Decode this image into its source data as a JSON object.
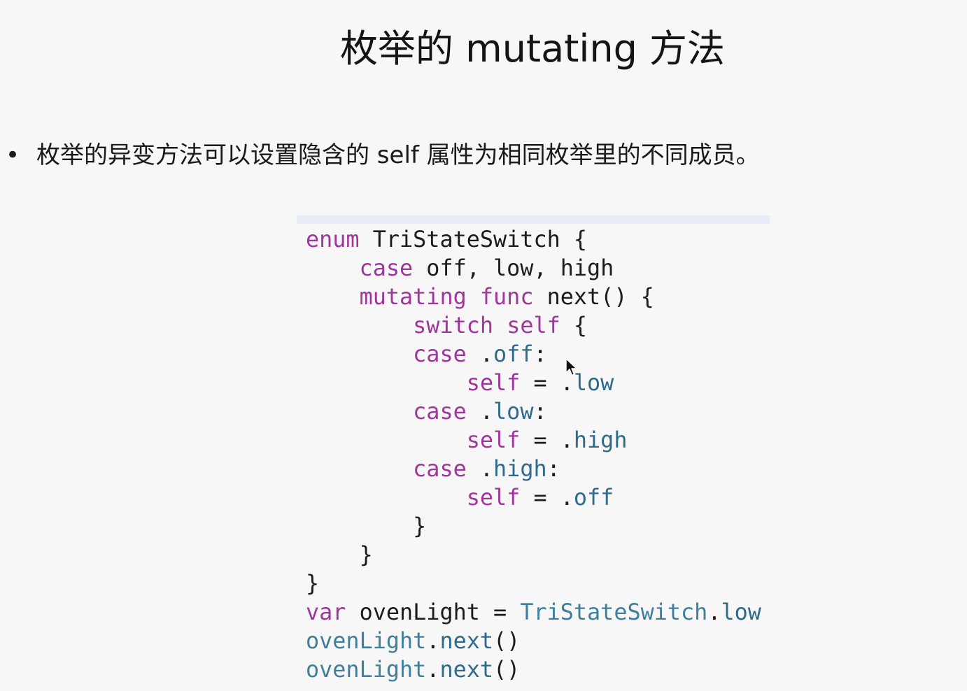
{
  "slide": {
    "title": "枚举的 mutating 方法",
    "bullet_marker": "•",
    "bullet_text": "枚举的异变方法可以设置隐含的 self 属性为相同枚举里的不同成员。"
  },
  "code": {
    "lines": [
      [
        {
          "t": "enum",
          "c": "kw"
        },
        {
          "t": " TriStateSwitch {",
          "c": "pl"
        }
      ],
      [
        {
          "t": "    ",
          "c": "pl"
        },
        {
          "t": "case",
          "c": "kw"
        },
        {
          "t": " off, low, high",
          "c": "pl"
        }
      ],
      [
        {
          "t": "    ",
          "c": "pl"
        },
        {
          "t": "mutating",
          "c": "kw"
        },
        {
          "t": " ",
          "c": "pl"
        },
        {
          "t": "func",
          "c": "kw"
        },
        {
          "t": " next() {",
          "c": "pl"
        }
      ],
      [
        {
          "t": "        ",
          "c": "pl"
        },
        {
          "t": "switch",
          "c": "kw"
        },
        {
          "t": " ",
          "c": "pl"
        },
        {
          "t": "self",
          "c": "kw"
        },
        {
          "t": " {",
          "c": "pl"
        }
      ],
      [
        {
          "t": "        ",
          "c": "pl"
        },
        {
          "t": "case",
          "c": "kw"
        },
        {
          "t": " .",
          "c": "pl"
        },
        {
          "t": "off",
          "c": "mem"
        },
        {
          "t": ":",
          "c": "pl"
        }
      ],
      [
        {
          "t": "            ",
          "c": "pl"
        },
        {
          "t": "self",
          "c": "kw"
        },
        {
          "t": " = .",
          "c": "pl"
        },
        {
          "t": "low",
          "c": "mem"
        }
      ],
      [
        {
          "t": "        ",
          "c": "pl"
        },
        {
          "t": "case",
          "c": "kw"
        },
        {
          "t": " .",
          "c": "pl"
        },
        {
          "t": "low",
          "c": "mem"
        },
        {
          "t": ":",
          "c": "pl"
        }
      ],
      [
        {
          "t": "            ",
          "c": "pl"
        },
        {
          "t": "self",
          "c": "kw"
        },
        {
          "t": " = .",
          "c": "pl"
        },
        {
          "t": "high",
          "c": "mem"
        }
      ],
      [
        {
          "t": "        ",
          "c": "pl"
        },
        {
          "t": "case",
          "c": "kw"
        },
        {
          "t": " .",
          "c": "pl"
        },
        {
          "t": "high",
          "c": "mem"
        },
        {
          "t": ":",
          "c": "pl"
        }
      ],
      [
        {
          "t": "            ",
          "c": "pl"
        },
        {
          "t": "self",
          "c": "kw"
        },
        {
          "t": " = .",
          "c": "pl"
        },
        {
          "t": "off",
          "c": "mem"
        }
      ],
      [
        {
          "t": "        }",
          "c": "pl"
        }
      ],
      [
        {
          "t": "    }",
          "c": "pl"
        }
      ],
      [
        {
          "t": "}",
          "c": "pl"
        }
      ],
      [
        {
          "t": "var",
          "c": "kw"
        },
        {
          "t": " ovenLight = ",
          "c": "pl"
        },
        {
          "t": "TriStateSwitch",
          "c": "ty"
        },
        {
          "t": ".",
          "c": "pl"
        },
        {
          "t": "low",
          "c": "mem"
        }
      ],
      [
        {
          "t": "ovenLight",
          "c": "ty"
        },
        {
          "t": ".",
          "c": "pl"
        },
        {
          "t": "next",
          "c": "mem"
        },
        {
          "t": "()",
          "c": "pl"
        }
      ],
      [
        {
          "t": "ovenLight",
          "c": "ty"
        },
        {
          "t": ".",
          "c": "pl"
        },
        {
          "t": "next",
          "c": "mem"
        },
        {
          "t": "()",
          "c": "pl"
        }
      ]
    ]
  },
  "colors": {
    "background": "#f7f7f7",
    "keyword": "#a0359c",
    "member": "#2f6a8c",
    "type": "#3f7f9c",
    "plain": "#1c1c1c",
    "code_topbar": "#e8edf6"
  },
  "icons": {
    "pointer": "mouse-pointer-icon"
  }
}
